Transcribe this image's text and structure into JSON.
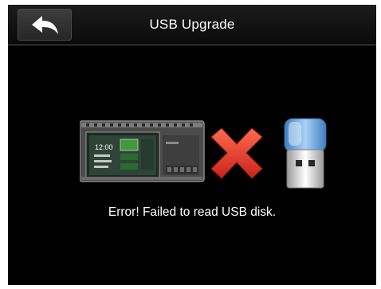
{
  "header": {
    "title": "USB Upgrade",
    "back_icon": "back-arrow-icon"
  },
  "device_screen": {
    "time": "12:00"
  },
  "message": "Error! Failed to read USB disk.",
  "icons": {
    "device": "terminal-device-icon",
    "error": "red-x-icon",
    "usb": "usb-drive-icon"
  },
  "colors": {
    "background": "#000000",
    "header": "#141414",
    "text": "#ffffff",
    "error_red": "#e23b2a",
    "usb_blue": "#6fa4d8",
    "device_green": "#3f9a3a"
  }
}
